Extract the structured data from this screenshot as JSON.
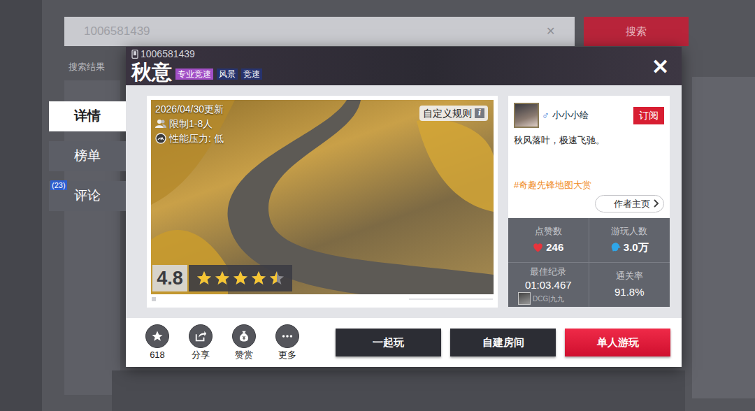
{
  "background": {
    "search_text": "1006581439",
    "clear_icon": "✕",
    "search_button": "搜索",
    "section_title": "搜索结果"
  },
  "side_tabs": [
    {
      "label": "详情",
      "selected": true,
      "badge": ""
    },
    {
      "label": "榜单",
      "selected": false,
      "badge": ""
    },
    {
      "label": "评论",
      "selected": false,
      "badge": "(23)"
    }
  ],
  "dialog": {
    "map_id": "1006581439",
    "title": "秋意",
    "close": "✕",
    "tags": [
      {
        "label": "专业竞速",
        "color": "#a24fc6"
      },
      {
        "label": "风景",
        "color": "#27336e"
      },
      {
        "label": "竞速",
        "color": "#27336e"
      }
    ]
  },
  "preview": {
    "updated": "2026/04/30更新",
    "players": "限制1-8人",
    "performance": "性能压力: 低",
    "rules_button": "自定义规则",
    "rules_icon": "i",
    "rating": "4.8",
    "stars": 4.5
  },
  "author": {
    "name": "小小小绘",
    "gender": "♂",
    "subscribe": "订阅",
    "description": "秋风落叶，极速飞驰。",
    "hashtag": "#奇趣先锋地图大赏",
    "homepage": "作者主页"
  },
  "stats": {
    "likes_label": "点赞数",
    "likes": "246",
    "players_label": "游玩人数",
    "players": "3.0万",
    "record_label": "最佳纪录",
    "record": "01:03.467",
    "record_holder": "DCG|九九",
    "pass_label": "通关率",
    "pass_rate": "91.8%"
  },
  "actions": [
    {
      "label": "618",
      "kind": "star"
    },
    {
      "label": "分享",
      "kind": "share"
    },
    {
      "label": "赞赏",
      "kind": "reward"
    },
    {
      "label": "更多",
      "kind": "more"
    }
  ],
  "buttons": [
    {
      "label": "一起玩",
      "kind": "secondary"
    },
    {
      "label": "自建房间",
      "kind": "secondary"
    },
    {
      "label": "单人游玩",
      "kind": "primary"
    }
  ]
}
